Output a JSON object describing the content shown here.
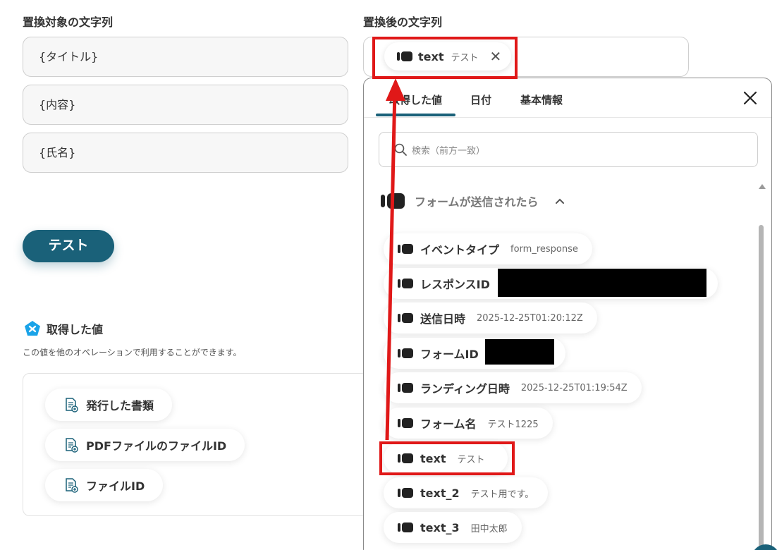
{
  "form": {
    "target_label": "置換対象の文字列",
    "replaced_label": "置換後の文字列",
    "target_fields": [
      "{タイトル}",
      "{内容}",
      "{氏名}"
    ],
    "test_button": "テスト",
    "replaced_token": {
      "name": "text",
      "value": "テスト"
    }
  },
  "acquired": {
    "title": "取得した値",
    "description": "この値を他のオペレーションで利用することができます。",
    "items": [
      "発行した書類",
      "PDFファイルのファイルID",
      "ファイルID"
    ]
  },
  "panel": {
    "tabs": [
      "取得した値",
      "日付",
      "基本情報"
    ],
    "active_tab": 0,
    "search_placeholder": "検索（前方一致）",
    "group_title": "フォームが送信されたら",
    "items": [
      {
        "name": "イベントタイプ",
        "value": "form_response"
      },
      {
        "name": "レスポンスID",
        "value": ""
      },
      {
        "name": "送信日時",
        "value": "2025-12-25T01:20:12Z"
      },
      {
        "name": "フォームID",
        "value": ""
      },
      {
        "name": "ランディング日時",
        "value": "2025-12-25T01:19:54Z"
      },
      {
        "name": "フォーム名",
        "value": "テスト1225"
      },
      {
        "name": "text",
        "value": "テスト"
      },
      {
        "name": "text_2",
        "value": "テスト用です。"
      },
      {
        "name": "text_3",
        "value": "田中太郎"
      }
    ]
  },
  "colors": {
    "accent": "#1a6179",
    "annotation": "#e01818",
    "brand_logo": "#1aa3e8"
  }
}
